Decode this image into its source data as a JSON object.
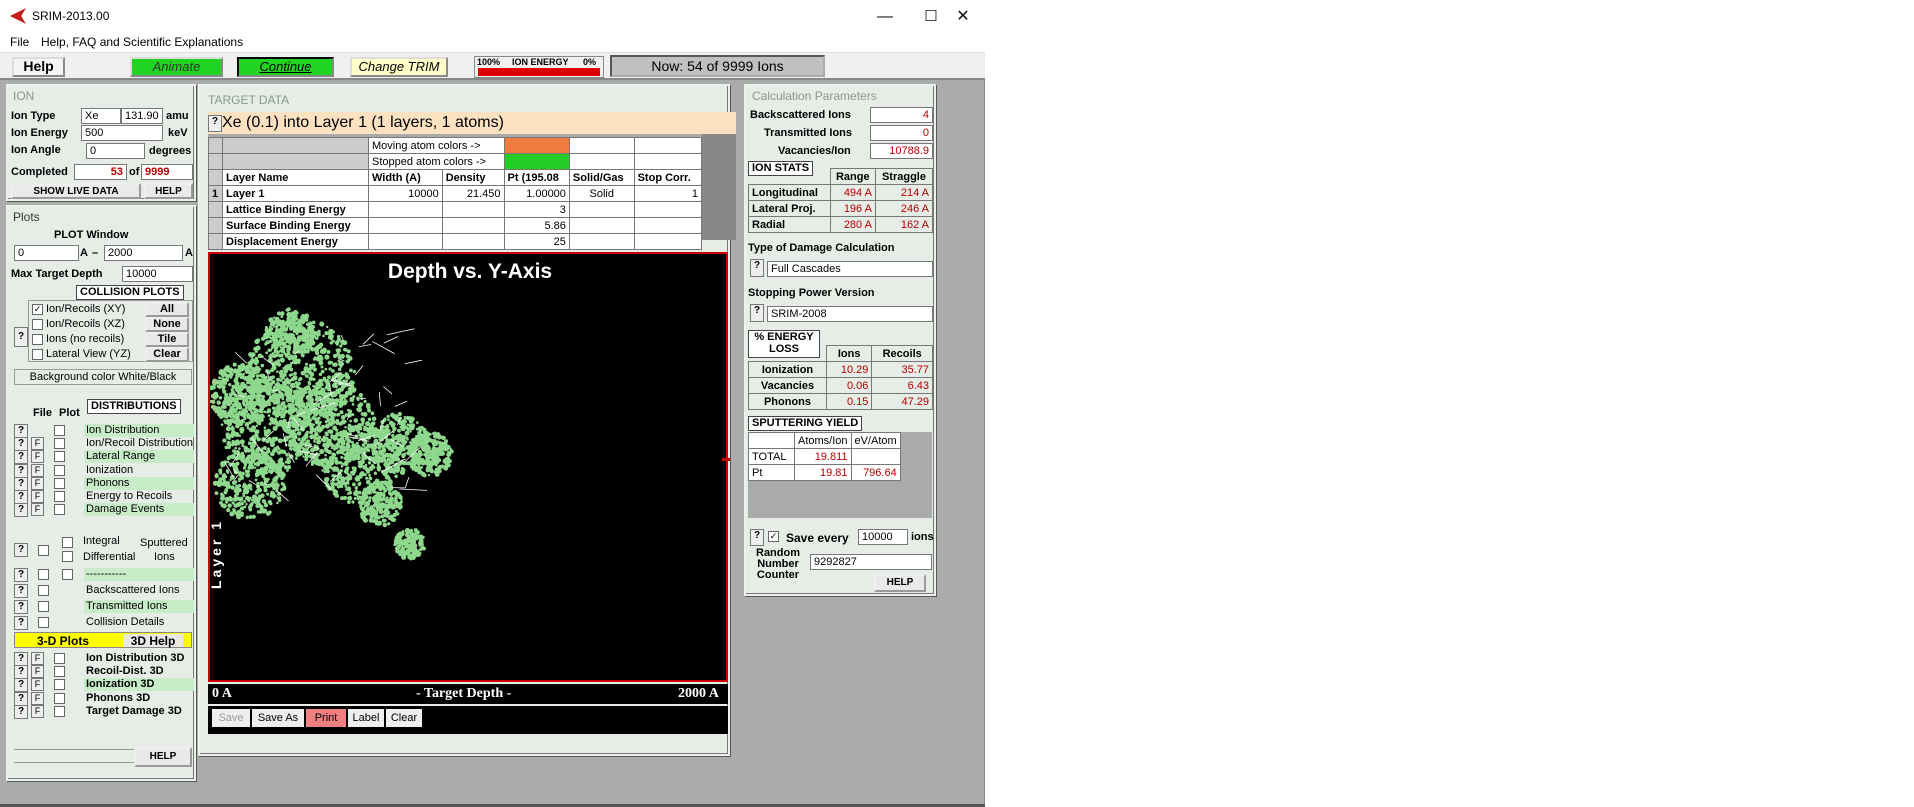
{
  "window": {
    "title": "SRIM-2013.00",
    "minimize": "—",
    "maximize": "☐",
    "close": "✕"
  },
  "menu": {
    "file": "File",
    "help": "Help, FAQ and Scientific Explanations"
  },
  "toolbar": {
    "help": "Help",
    "animate": "Animate",
    "continue": "Continue",
    "change_trim": "Change TRIM",
    "energy_left": "100%",
    "energy_label": "ION ENERGY",
    "energy_right": "0%",
    "ion_energy_remaining": 1.0,
    "now": "Now: 54 of 9999 Ions"
  },
  "ion": {
    "heading": "ION",
    "type_label": "Ion Type",
    "type": "Xe",
    "mass": "131.90",
    "mass_unit": "amu",
    "energy_label": "Ion Energy",
    "energy": "500",
    "energy_unit": "keV",
    "angle_label": "Ion Angle",
    "angle": "0",
    "angle_unit": "degrees",
    "completed_label": "Completed",
    "completed": "53",
    "of": "of",
    "total": "9999",
    "show_live": "SHOW LIVE DATA",
    "help": "HELP"
  },
  "plots": {
    "heading": "Plots",
    "window_label": "PLOT  Window",
    "min": "0",
    "unit1": "A",
    "dash": "–",
    "max": "2000",
    "unit2": "A",
    "max_depth_label": "Max Target Depth",
    "max_depth": "10000",
    "collision_header": "COLLISION PLOTS",
    "q": "?",
    "collision": [
      {
        "label": "Ion/Recoils (XY)",
        "checked": "✓",
        "btn": "All"
      },
      {
        "label": "Ion/Recoils (XZ)",
        "checked": "",
        "btn": "None"
      },
      {
        "label": "Ions (no recoils)",
        "checked": "",
        "btn": "Tile"
      },
      {
        "label": "Lateral View (YZ)",
        "checked": "",
        "btn": "Clear"
      }
    ],
    "bg_color": "Background color White/Black",
    "dist_header": "DISTRIBUTIONS",
    "file_label": "File",
    "plot_label": "Plot",
    "distributions": [
      "Ion Distribution",
      "Ion/Recoil Distribution",
      "Lateral Range",
      "Ionization",
      "Phonons",
      "Energy to Recoils",
      "Damage Events"
    ],
    "integral": "Integral",
    "differential": "Differential",
    "sputtered": "Sputtered",
    "ions": "Ions",
    "dashes": "-----------",
    "backscattered": "Backscattered Ions",
    "transmitted": "Transmitted Ions",
    "collision_details": "Collision Details",
    "plots3d": "3-D Plots",
    "help3d": "3D Help",
    "dist3d": [
      "Ion Distribution 3D",
      "Recoil-Dist. 3D",
      "Ionization 3D",
      "Phonons 3D",
      "Target Damage 3D"
    ],
    "help": "HELP"
  },
  "target": {
    "heading": "TARGET DATA",
    "title": "Xe (0.1) into Layer 1 (1 layers, 1 atoms)",
    "moving": "Moving atom colors ->",
    "stopped": "Stopped atom colors ->",
    "moving_color": "#f07b3f",
    "stopped_color": "#22cc22",
    "cols": [
      "Layer Name",
      "Width (A)",
      "Density",
      "Pt (195.08",
      "Solid/Gas",
      "Stop Corr."
    ],
    "row_num": "1",
    "row": [
      "Layer 1",
      "10000",
      "21.450",
      "1.00000",
      "Solid",
      "1"
    ],
    "lattice": "Lattice Binding Energy",
    "lattice_val": "3",
    "surface": "Surface Binding Energy",
    "surface_val": "5.86",
    "displacement": "Displacement Energy",
    "displacement_val": "25"
  },
  "plot": {
    "title": "Depth vs. Y-Axis",
    "layer": "Layer 1",
    "x0": "0 A",
    "xlabel": "- Target Depth -",
    "x1": "2000 A",
    "cascade_color": "#8ed88e",
    "buttons": {
      "save": "Save",
      "save_as": "Save As",
      "print": "Print",
      "label": "Label",
      "clear": "Clear"
    }
  },
  "calc": {
    "heading": "Calculation Parameters",
    "backscattered_label": "Backscattered Ions",
    "backscattered": "4",
    "transmitted_label": "Transmitted Ions",
    "transmitted": "0",
    "vacancies_label": "Vacancies/Ion",
    "vacancies": "10788.9",
    "ion_stats": "ION STATS",
    "range": "Range",
    "straggle": "Straggle",
    "stats": [
      {
        "label": "Longitudinal",
        "range": "494 A",
        "straggle": "214 A"
      },
      {
        "label": "Lateral Proj.",
        "range": "196 A",
        "straggle": "246 A"
      },
      {
        "label": "Radial",
        "range": "280 A",
        "straggle": "162 A"
      }
    ],
    "damage_type_label": "Type of Damage Calculation",
    "damage_type": "Full Cascades",
    "stopping_label": "Stopping Power Version",
    "stopping": "SRIM-2008",
    "energy_loss1": "% ENERGY",
    "energy_loss2": "LOSS",
    "ions": "Ions",
    "recoils": "Recoils",
    "loss": [
      {
        "label": "Ionization",
        "ions": "10.29",
        "recoils": "35.77"
      },
      {
        "label": "Vacancies",
        "ions": "0.06",
        "recoils": "6.43"
      },
      {
        "label": "Phonons",
        "ions": "0.15",
        "recoils": "47.29"
      }
    ],
    "sputtering": "SPUTTERING YIELD",
    "atoms_ion": "Atoms/Ion",
    "ev_atom": "eV/Atom",
    "sputter_rows": [
      {
        "label": "TOTAL",
        "atoms": "19.811",
        "ev": ""
      },
      {
        "label": "Pt",
        "atoms": "19.81",
        "ev": "796.64"
      }
    ],
    "save_every": "Save every",
    "save_checked": "✓",
    "save_n": "10000",
    "save_unit": "ions",
    "random1": "Random",
    "random2": "Number",
    "random3": "Counter",
    "random": "9292827",
    "help": "HELP",
    "q": "?"
  }
}
